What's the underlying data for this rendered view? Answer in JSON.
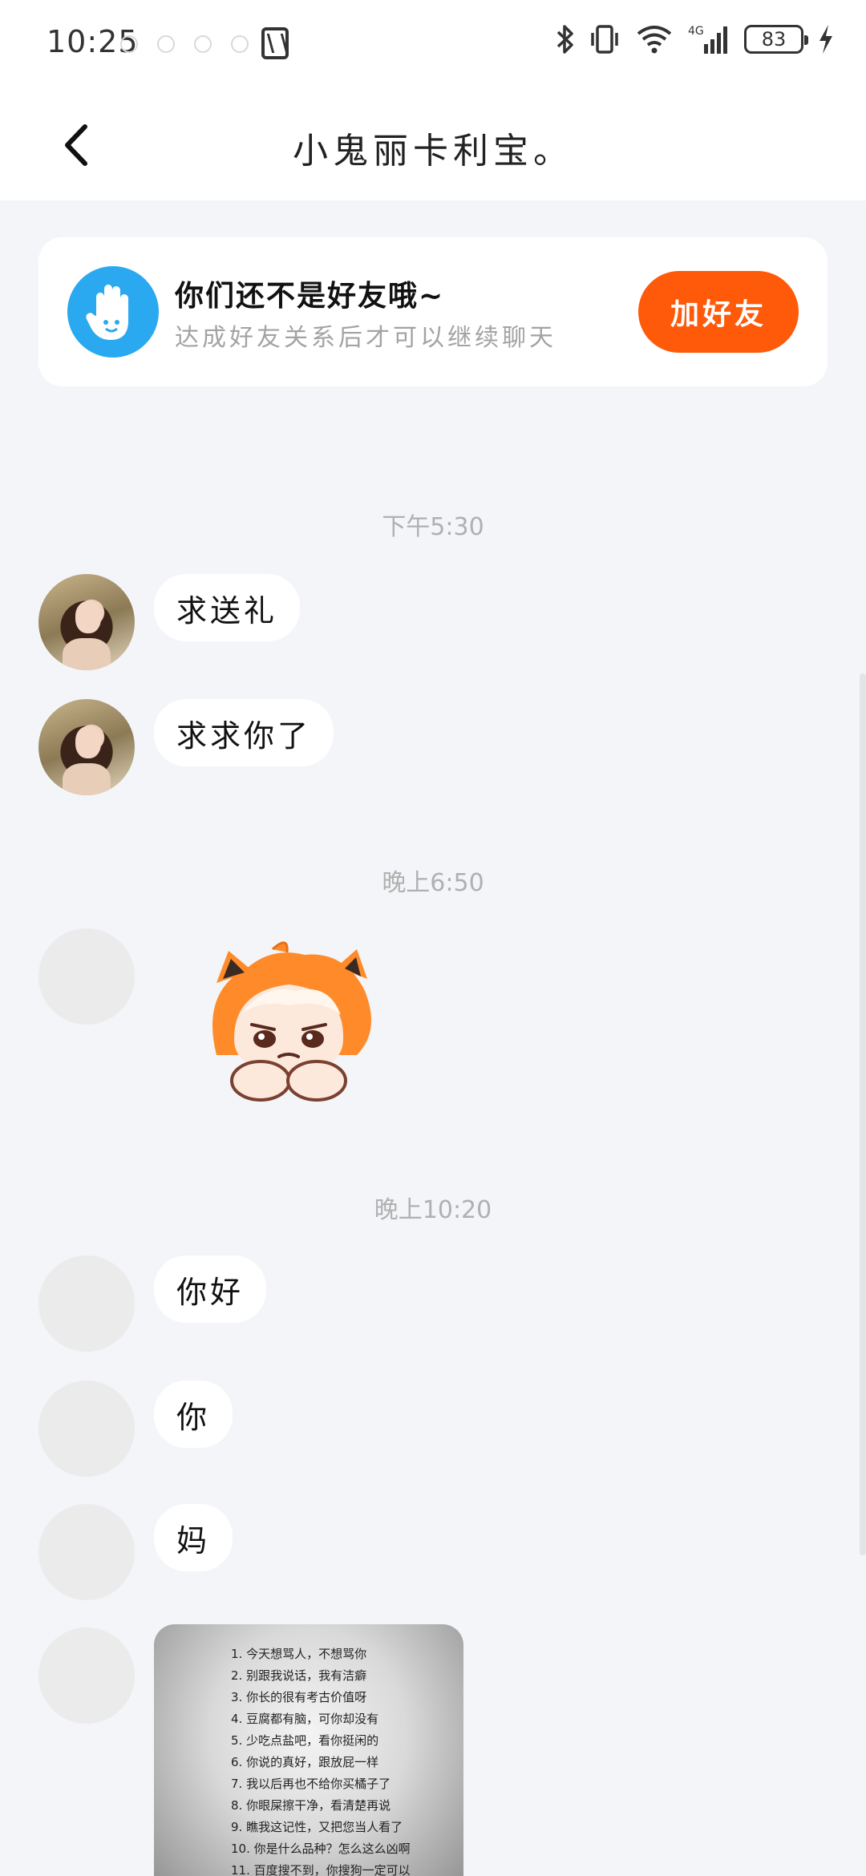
{
  "status_bar": {
    "time": "10:25",
    "battery": "83",
    "network": "4G"
  },
  "header": {
    "title": "小鬼丽卡利宝。",
    "back_icon": "chevron-left-icon"
  },
  "friend_card": {
    "title": "你们还不是好友哦~",
    "subtitle": "达成好友关系后才可以继续聊天",
    "button": "加好友",
    "accent": "#ff5a0a",
    "badge_color": "#2aa8f0",
    "icon": "wave-hand-icon"
  },
  "messages": {
    "time1": "下午5:30",
    "m1": "求送礼",
    "m2": "求求你了",
    "time2": "晚上6:50",
    "sticker": "crying-girl-sticker",
    "time3": "晚上10:20",
    "m4": "你好",
    "m5": "你",
    "m6": "妈"
  },
  "image_message": {
    "lines": [
      "1. 今天想骂人，不想骂你",
      "2. 别跟我说话，我有洁癖",
      "3. 你长的很有考古价值呀",
      "4. 豆腐都有脑，可你却没有",
      "5. 少吃点盐吧，看你挺闲的",
      "6. 你说的真好，跟放屁一样",
      "7. 我以后再也不给你买橘子了",
      "8. 你眼屎擦干净，看清楚再说",
      "9. 瞧我这记性，又把您当人看了",
      "10. 你是什么品种？怎么这么凶啊",
      "11. 百度搜不到，你搜狗一定可以"
    ]
  }
}
